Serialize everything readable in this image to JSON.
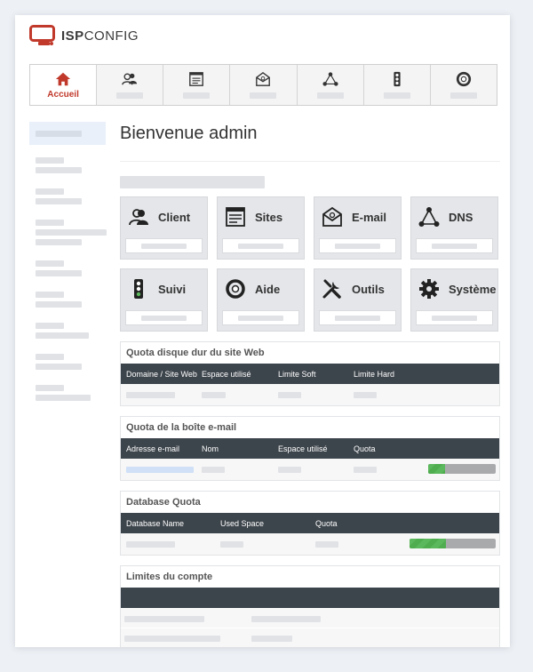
{
  "app": {
    "brand_bold": "ISP",
    "brand_light": "CONFIG",
    "logo_color": "#c0392b"
  },
  "topnav": {
    "tabs": [
      {
        "label": "Accueil",
        "icon": "home-icon",
        "active": true
      },
      {
        "icon": "client-icon"
      },
      {
        "icon": "sites-icon"
      },
      {
        "icon": "email-icon"
      },
      {
        "icon": "dns-icon"
      },
      {
        "icon": "monitor-icon"
      },
      {
        "icon": "help-icon"
      }
    ]
  },
  "main": {
    "title": "Bienvenue admin"
  },
  "tiles": [
    {
      "label": "Client",
      "icon": "client-icon"
    },
    {
      "label": "Sites",
      "icon": "sites-icon"
    },
    {
      "label": "E-mail",
      "icon": "email-icon"
    },
    {
      "label": "DNS",
      "icon": "dns-icon"
    },
    {
      "label": "Suivi",
      "icon": "monitor-icon"
    },
    {
      "label": "Aide",
      "icon": "help-icon"
    },
    {
      "label": "Outils",
      "icon": "tools-icon"
    },
    {
      "label": "Système",
      "icon": "gear-icon"
    }
  ],
  "web_quota": {
    "title": "Quota disque dur du site Web",
    "columns": [
      "Domaine / Site Web",
      "Espace utilisé",
      "Limite Soft",
      "Limite Hard"
    ]
  },
  "mail_quota": {
    "title": "Quota de la boîte e-mail",
    "columns": [
      "Adresse e-mail",
      "Nom",
      "Espace utilisé",
      "Quota"
    ],
    "quota_fill_percent": 25
  },
  "db_quota": {
    "title": "Database Quota",
    "columns": [
      "Database Name",
      "Used Space",
      "Quota"
    ],
    "quota_fill_percent": 42
  },
  "limits": {
    "title": "Limites du compte"
  }
}
